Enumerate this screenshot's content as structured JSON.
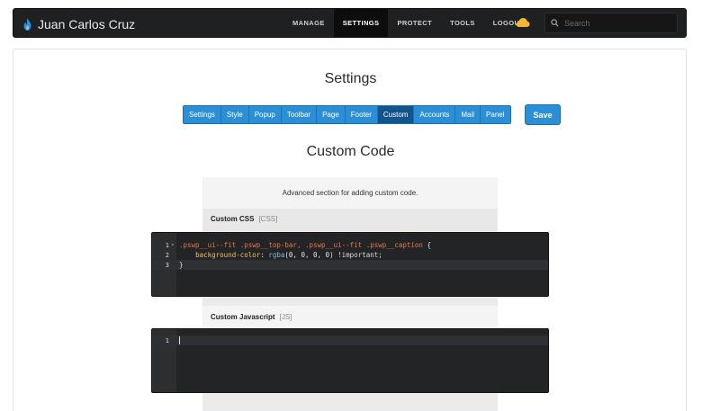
{
  "nav": {
    "brand": "Juan Carlos Cruz",
    "links": [
      "MANAGE",
      "SETTINGS",
      "PROTECT",
      "TOOLS",
      "LOGOUT"
    ],
    "active_link": "SETTINGS",
    "search_placeholder": "Search",
    "brand_icon": "flame-icon",
    "weather_icon": "cloud-icon",
    "colors": {
      "navbar": "#1f2022",
      "cloud": "#f5b731",
      "flame": "#2c8fd6"
    }
  },
  "page": {
    "title": "Settings",
    "tabs": [
      "Settings",
      "Style",
      "Popup",
      "Toolbar",
      "Page",
      "Footer",
      "Custom",
      "Accounts",
      "Mail",
      "Panel"
    ],
    "active_tab": "Custom",
    "save_label": "Save",
    "section_title": "Custom Code",
    "section_description": "Advanced section for adding custom code.",
    "accent": "#2c8fd6"
  },
  "custom_css": {
    "label": "Custom CSS",
    "tag": "[CSS]",
    "line_numbers": [
      "1",
      "2",
      "3"
    ],
    "line1_selector": ".pswp__ui--fit .pswp__top-bar, .pswp__ui--fit .pswp__caption",
    "line1_brace": " {",
    "line2_property": "background-color",
    "line2_colon": ": ",
    "line2_function": "rgba",
    "line2_args": "(0, 0, 0, 0)",
    "line2_important": " !important;",
    "line3_text": "}"
  },
  "custom_js": {
    "label": "Custom Javascript",
    "tag": "[JS]",
    "line_numbers": [
      "1"
    ]
  }
}
